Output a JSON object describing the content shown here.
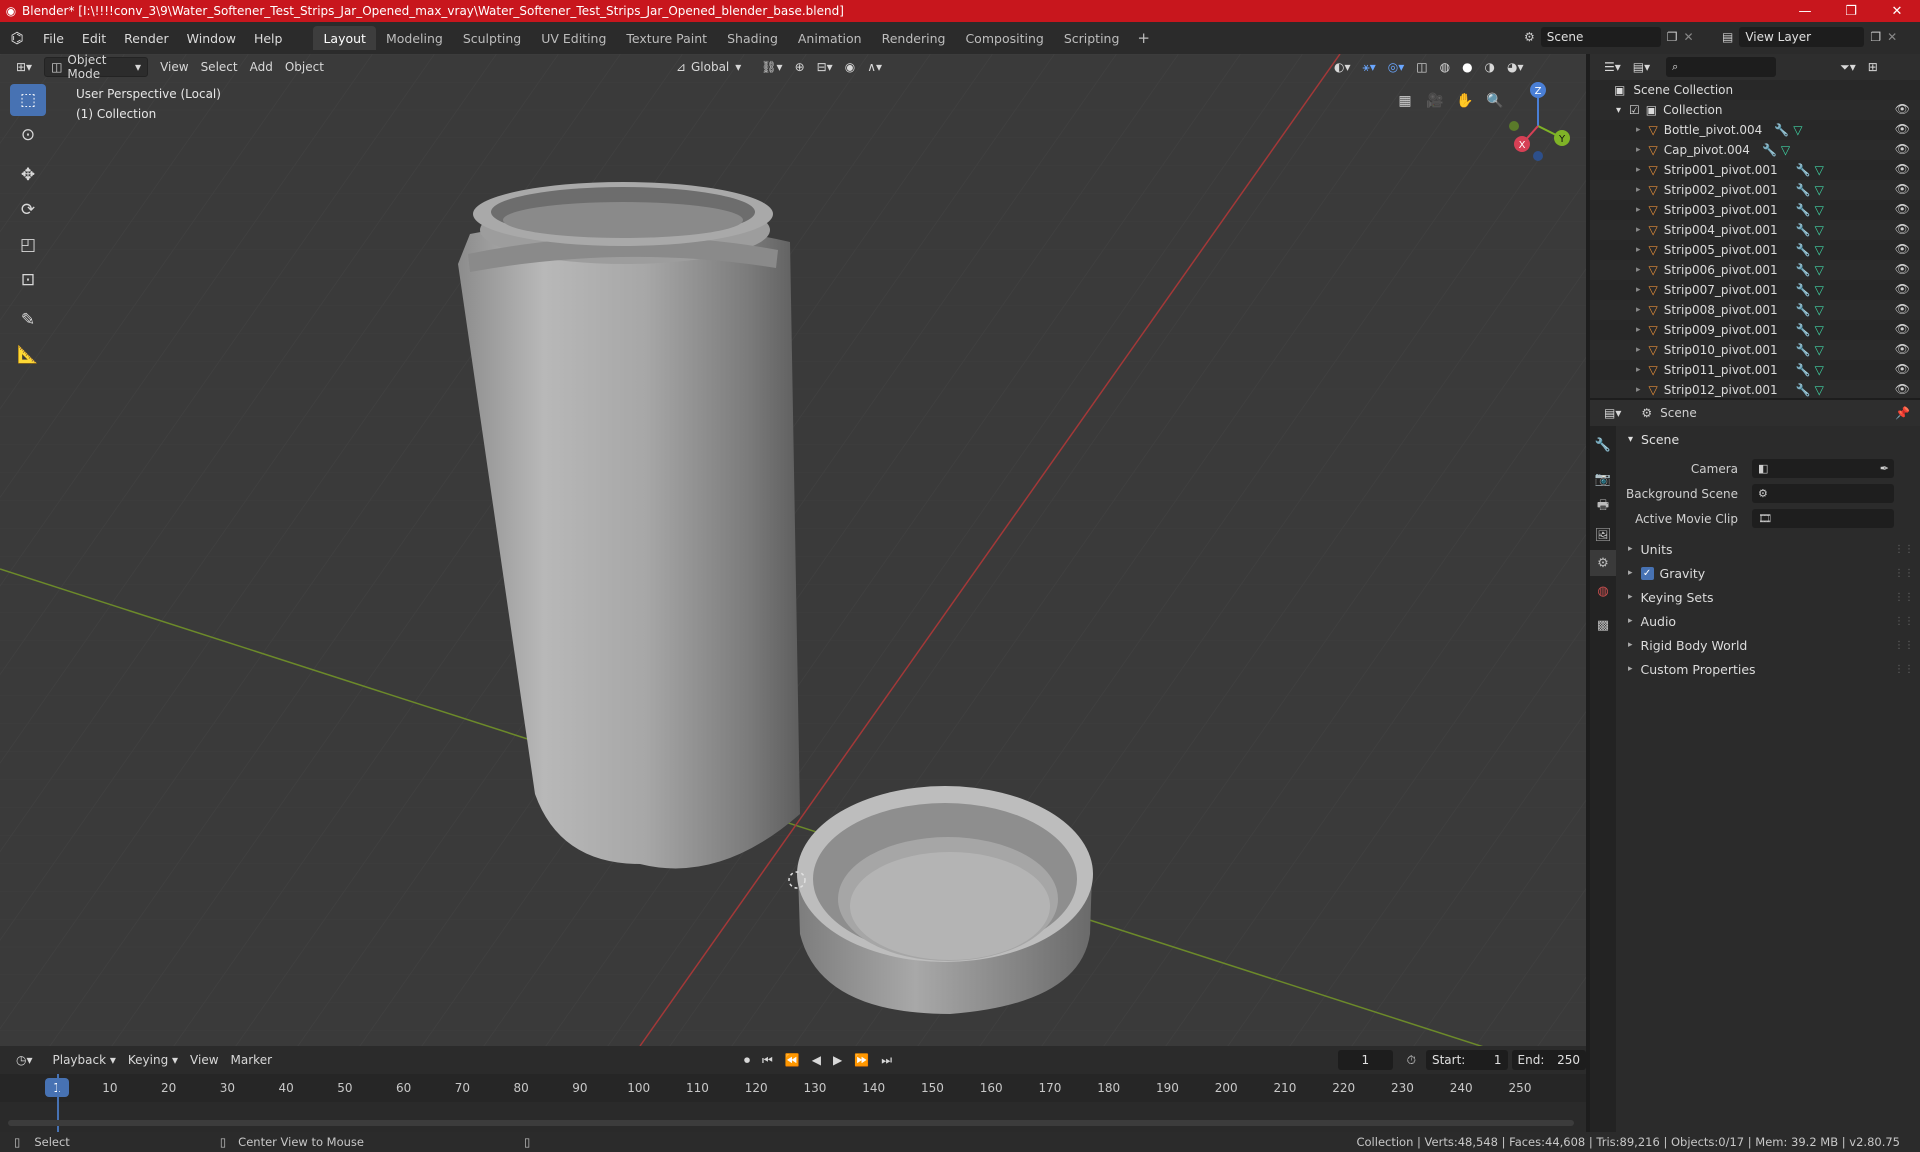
{
  "titlebar": {
    "title": "Blender* [I:\\!!!!conv_3\\9\\Water_Softener_Test_Strips_Jar_Opened_max_vray\\Water_Softener_Test_Strips_Jar_Opened_blender_base.blend]",
    "minimize": "—",
    "maximize": "❐",
    "close": "✕"
  },
  "menu": {
    "items": [
      "File",
      "Edit",
      "Render",
      "Window",
      "Help"
    ]
  },
  "workspaces": {
    "tabs": [
      "Layout",
      "Modeling",
      "Sculpting",
      "UV Editing",
      "Texture Paint",
      "Shading",
      "Animation",
      "Rendering",
      "Compositing",
      "Scripting"
    ],
    "active": "Layout",
    "add": "+"
  },
  "scene_selector": {
    "value": "Scene"
  },
  "view_layer_selector": {
    "value": "View Layer"
  },
  "viewport": {
    "mode": "Object Mode",
    "menus": [
      "View",
      "Select",
      "Add",
      "Object"
    ],
    "orientation": "Global",
    "info_line1": "User Perspective (Local)",
    "info_line2": "(1) Collection",
    "gizmo_labels": {
      "x": "X",
      "y": "Y",
      "z": "Z"
    }
  },
  "outliner": {
    "search_placeholder": "",
    "root": "Scene Collection",
    "collection": "Collection",
    "items": [
      "Bottle_pivot.004",
      "Cap_pivot.004",
      "Strip001_pivot.001",
      "Strip002_pivot.001",
      "Strip003_pivot.001",
      "Strip004_pivot.001",
      "Strip005_pivot.001",
      "Strip006_pivot.001",
      "Strip007_pivot.001",
      "Strip008_pivot.001",
      "Strip009_pivot.001",
      "Strip010_pivot.001",
      "Strip011_pivot.001",
      "Strip012_pivot.001"
    ]
  },
  "properties": {
    "header": "Scene",
    "panel": "Scene",
    "fields": [
      {
        "label": "Camera"
      },
      {
        "label": "Background Scene"
      },
      {
        "label": "Active Movie Clip"
      }
    ],
    "collapsed": [
      "Units",
      "Gravity",
      "Keying Sets",
      "Audio",
      "Rigid Body World",
      "Custom Properties"
    ]
  },
  "timeline": {
    "menus": [
      "Playback",
      "Keying",
      "View",
      "Marker"
    ],
    "current_frame": "1",
    "start_label": "Start:",
    "start": "1",
    "end_label": "End:",
    "end": "250",
    "ruler": [
      "1",
      "10",
      "20",
      "30",
      "40",
      "50",
      "60",
      "70",
      "80",
      "90",
      "100",
      "110",
      "120",
      "130",
      "140",
      "150",
      "160",
      "170",
      "180",
      "190",
      "200",
      "210",
      "220",
      "230",
      "240",
      "250"
    ]
  },
  "statusbar": {
    "select": "Select",
    "center": "Center View to Mouse",
    "stats": "Collection | Verts:48,548 | Faces:44,608 | Tris:89,216 | Objects:0/17 | Mem: 39.2 MB | v2.80.75"
  }
}
